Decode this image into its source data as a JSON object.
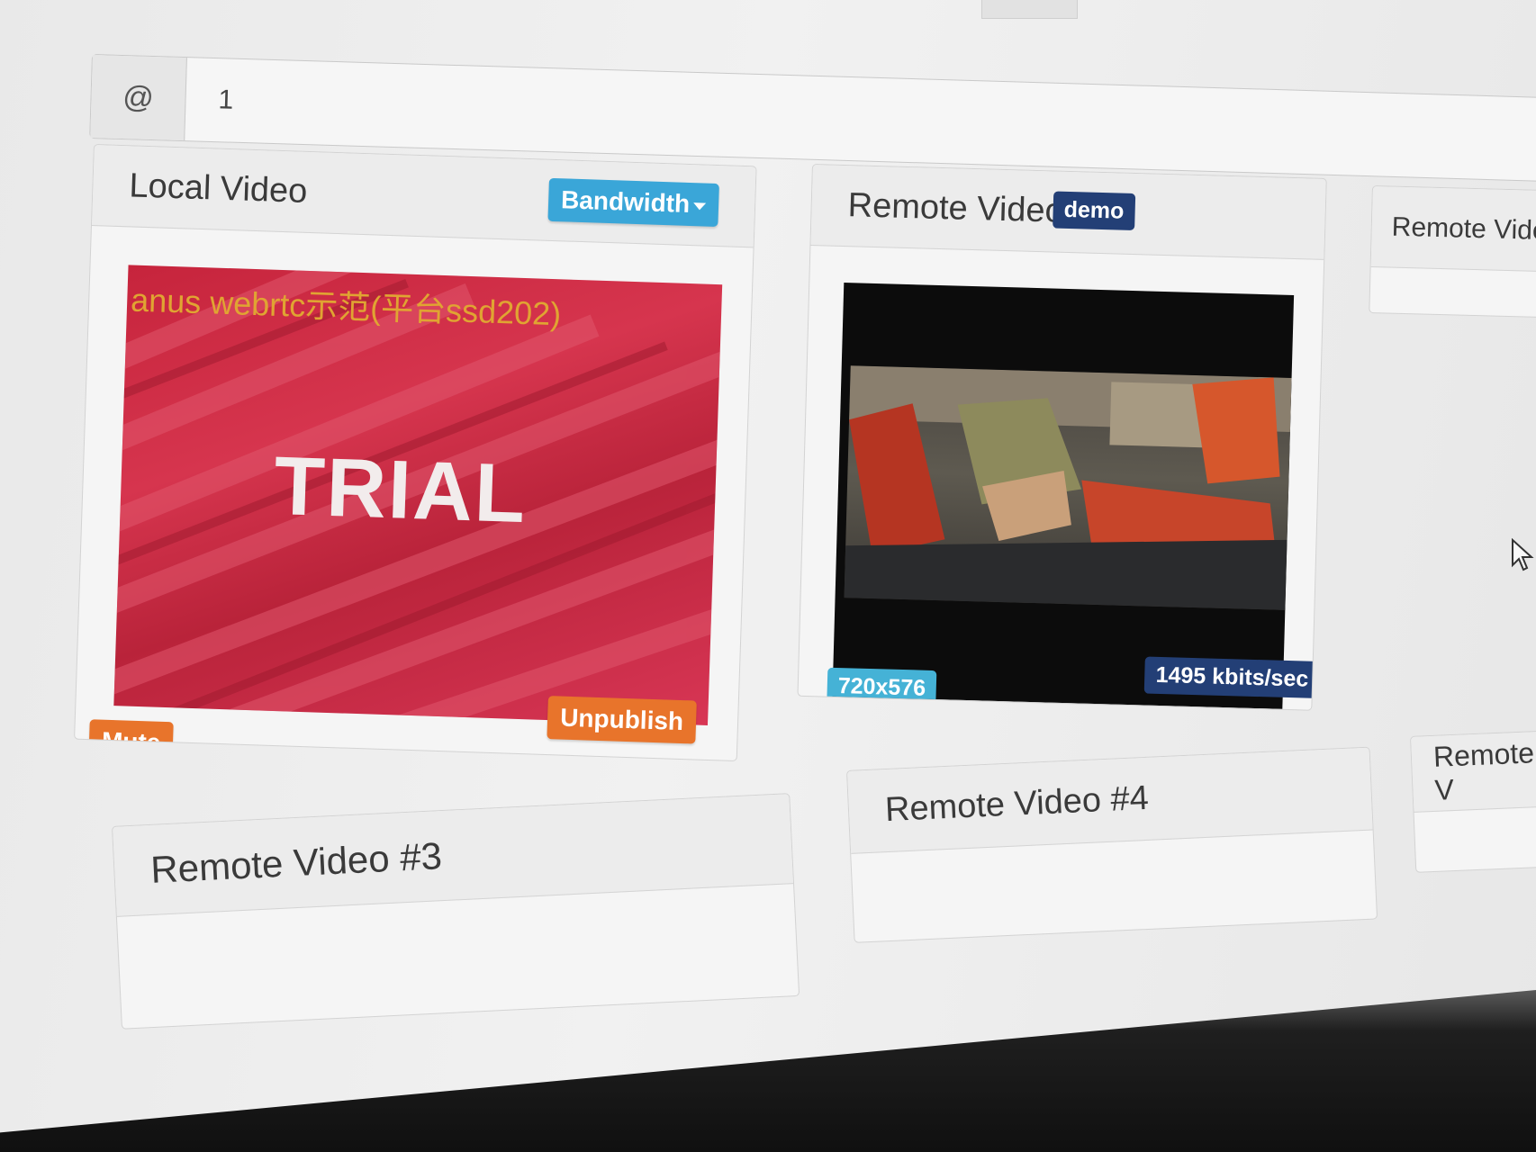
{
  "input_group": {
    "addon": "@",
    "value": "1"
  },
  "local_panel": {
    "title": "Local Video",
    "bandwidth_label": "Bandwidth",
    "watermark": "anus webrtc示范(平台ssd202)",
    "overlay_text": "TRIAL",
    "unpublish_label": "Unpublish",
    "mute_label": "Mute"
  },
  "remote1_panel": {
    "title": "Remote Video #1",
    "badge": "demo",
    "resolution": "720x576",
    "bitrate": "1495 kbits/sec"
  },
  "remote2_panel": {
    "title": "Remote Video"
  },
  "remote3_panel": {
    "title": "Remote Video #3"
  },
  "remote4_panel": {
    "title": "Remote Video #4"
  },
  "remote5_panel": {
    "title": "Remote V"
  },
  "colors": {
    "info": "#3aa6d8",
    "warning": "#e8742b",
    "primary": "#233f76",
    "label_info": "#45b2d6"
  },
  "icons": {
    "cursor": "mouse-pointer-icon",
    "dropdown": "caret-down-icon"
  }
}
